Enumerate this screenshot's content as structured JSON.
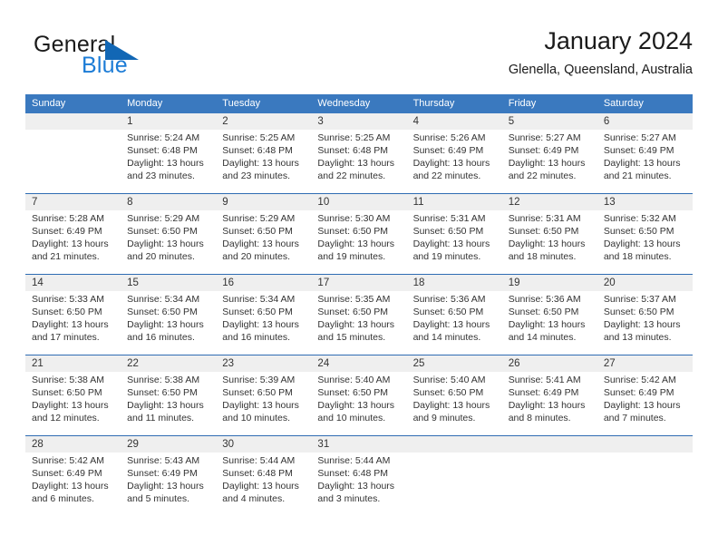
{
  "brand": {
    "name_dark": "General",
    "name_blue": "Blue",
    "triangle_color": "#1267b5",
    "blue_text_color": "#1c7cd6"
  },
  "header": {
    "title": "January 2024",
    "subtitle": "Glenella, Queensland, Australia"
  },
  "theme": {
    "header_bar_color": "#3a79bf",
    "separator_color": "#2f6cb3",
    "daynum_band_color": "#efefef",
    "text_color": "#333333"
  },
  "weekdays": [
    "Sunday",
    "Monday",
    "Tuesday",
    "Wednesday",
    "Thursday",
    "Friday",
    "Saturday"
  ],
  "weeks": [
    [
      {
        "day": "",
        "lines": []
      },
      {
        "day": "1",
        "lines": [
          "Sunrise: 5:24 AM",
          "Sunset: 6:48 PM",
          "Daylight: 13 hours",
          "and 23 minutes."
        ]
      },
      {
        "day": "2",
        "lines": [
          "Sunrise: 5:25 AM",
          "Sunset: 6:48 PM",
          "Daylight: 13 hours",
          "and 23 minutes."
        ]
      },
      {
        "day": "3",
        "lines": [
          "Sunrise: 5:25 AM",
          "Sunset: 6:48 PM",
          "Daylight: 13 hours",
          "and 22 minutes."
        ]
      },
      {
        "day": "4",
        "lines": [
          "Sunrise: 5:26 AM",
          "Sunset: 6:49 PM",
          "Daylight: 13 hours",
          "and 22 minutes."
        ]
      },
      {
        "day": "5",
        "lines": [
          "Sunrise: 5:27 AM",
          "Sunset: 6:49 PM",
          "Daylight: 13 hours",
          "and 22 minutes."
        ]
      },
      {
        "day": "6",
        "lines": [
          "Sunrise: 5:27 AM",
          "Sunset: 6:49 PM",
          "Daylight: 13 hours",
          "and 21 minutes."
        ]
      }
    ],
    [
      {
        "day": "7",
        "lines": [
          "Sunrise: 5:28 AM",
          "Sunset: 6:49 PM",
          "Daylight: 13 hours",
          "and 21 minutes."
        ]
      },
      {
        "day": "8",
        "lines": [
          "Sunrise: 5:29 AM",
          "Sunset: 6:50 PM",
          "Daylight: 13 hours",
          "and 20 minutes."
        ]
      },
      {
        "day": "9",
        "lines": [
          "Sunrise: 5:29 AM",
          "Sunset: 6:50 PM",
          "Daylight: 13 hours",
          "and 20 minutes."
        ]
      },
      {
        "day": "10",
        "lines": [
          "Sunrise: 5:30 AM",
          "Sunset: 6:50 PM",
          "Daylight: 13 hours",
          "and 19 minutes."
        ]
      },
      {
        "day": "11",
        "lines": [
          "Sunrise: 5:31 AM",
          "Sunset: 6:50 PM",
          "Daylight: 13 hours",
          "and 19 minutes."
        ]
      },
      {
        "day": "12",
        "lines": [
          "Sunrise: 5:31 AM",
          "Sunset: 6:50 PM",
          "Daylight: 13 hours",
          "and 18 minutes."
        ]
      },
      {
        "day": "13",
        "lines": [
          "Sunrise: 5:32 AM",
          "Sunset: 6:50 PM",
          "Daylight: 13 hours",
          "and 18 minutes."
        ]
      }
    ],
    [
      {
        "day": "14",
        "lines": [
          "Sunrise: 5:33 AM",
          "Sunset: 6:50 PM",
          "Daylight: 13 hours",
          "and 17 minutes."
        ]
      },
      {
        "day": "15",
        "lines": [
          "Sunrise: 5:34 AM",
          "Sunset: 6:50 PM",
          "Daylight: 13 hours",
          "and 16 minutes."
        ]
      },
      {
        "day": "16",
        "lines": [
          "Sunrise: 5:34 AM",
          "Sunset: 6:50 PM",
          "Daylight: 13 hours",
          "and 16 minutes."
        ]
      },
      {
        "day": "17",
        "lines": [
          "Sunrise: 5:35 AM",
          "Sunset: 6:50 PM",
          "Daylight: 13 hours",
          "and 15 minutes."
        ]
      },
      {
        "day": "18",
        "lines": [
          "Sunrise: 5:36 AM",
          "Sunset: 6:50 PM",
          "Daylight: 13 hours",
          "and 14 minutes."
        ]
      },
      {
        "day": "19",
        "lines": [
          "Sunrise: 5:36 AM",
          "Sunset: 6:50 PM",
          "Daylight: 13 hours",
          "and 14 minutes."
        ]
      },
      {
        "day": "20",
        "lines": [
          "Sunrise: 5:37 AM",
          "Sunset: 6:50 PM",
          "Daylight: 13 hours",
          "and 13 minutes."
        ]
      }
    ],
    [
      {
        "day": "21",
        "lines": [
          "Sunrise: 5:38 AM",
          "Sunset: 6:50 PM",
          "Daylight: 13 hours",
          "and 12 minutes."
        ]
      },
      {
        "day": "22",
        "lines": [
          "Sunrise: 5:38 AM",
          "Sunset: 6:50 PM",
          "Daylight: 13 hours",
          "and 11 minutes."
        ]
      },
      {
        "day": "23",
        "lines": [
          "Sunrise: 5:39 AM",
          "Sunset: 6:50 PM",
          "Daylight: 13 hours",
          "and 10 minutes."
        ]
      },
      {
        "day": "24",
        "lines": [
          "Sunrise: 5:40 AM",
          "Sunset: 6:50 PM",
          "Daylight: 13 hours",
          "and 10 minutes."
        ]
      },
      {
        "day": "25",
        "lines": [
          "Sunrise: 5:40 AM",
          "Sunset: 6:50 PM",
          "Daylight: 13 hours",
          "and 9 minutes."
        ]
      },
      {
        "day": "26",
        "lines": [
          "Sunrise: 5:41 AM",
          "Sunset: 6:49 PM",
          "Daylight: 13 hours",
          "and 8 minutes."
        ]
      },
      {
        "day": "27",
        "lines": [
          "Sunrise: 5:42 AM",
          "Sunset: 6:49 PM",
          "Daylight: 13 hours",
          "and 7 minutes."
        ]
      }
    ],
    [
      {
        "day": "28",
        "lines": [
          "Sunrise: 5:42 AM",
          "Sunset: 6:49 PM",
          "Daylight: 13 hours",
          "and 6 minutes."
        ]
      },
      {
        "day": "29",
        "lines": [
          "Sunrise: 5:43 AM",
          "Sunset: 6:49 PM",
          "Daylight: 13 hours",
          "and 5 minutes."
        ]
      },
      {
        "day": "30",
        "lines": [
          "Sunrise: 5:44 AM",
          "Sunset: 6:48 PM",
          "Daylight: 13 hours",
          "and 4 minutes."
        ]
      },
      {
        "day": "31",
        "lines": [
          "Sunrise: 5:44 AM",
          "Sunset: 6:48 PM",
          "Daylight: 13 hours",
          "and 3 minutes."
        ]
      },
      {
        "day": "",
        "lines": []
      },
      {
        "day": "",
        "lines": []
      },
      {
        "day": "",
        "lines": []
      }
    ]
  ]
}
